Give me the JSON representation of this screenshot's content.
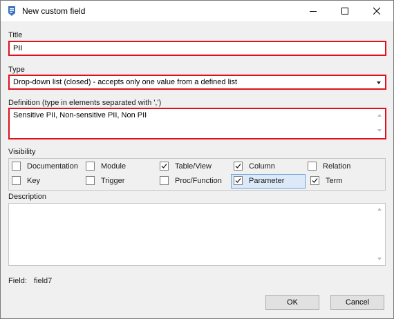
{
  "window": {
    "title": "New custom field",
    "minimize_icon": "minimize-icon",
    "maximize_icon": "maximize-icon",
    "close_icon": "close-icon"
  },
  "title_field": {
    "label": "Title",
    "value": "PII"
  },
  "type_field": {
    "label": "Type",
    "selected": "Drop-down list (closed) - accepts only one value from a defined list"
  },
  "definition_field": {
    "label": "Definition (type in elements separated with ',')",
    "value": "Sensitive PII, Non-sensitive PII, Non PII"
  },
  "visibility": {
    "label": "Visibility",
    "items": [
      {
        "label": "Documentation",
        "checked": false
      },
      {
        "label": "Module",
        "checked": false
      },
      {
        "label": "Table/View",
        "checked": true
      },
      {
        "label": "Column",
        "checked": true
      },
      {
        "label": "Relation",
        "checked": false
      },
      {
        "label": "Key",
        "checked": false
      },
      {
        "label": "Trigger",
        "checked": false
      },
      {
        "label": "Proc/Function",
        "checked": false
      },
      {
        "label": "Parameter",
        "checked": true
      },
      {
        "label": "Term",
        "checked": true
      }
    ]
  },
  "description": {
    "label": "Description",
    "value": ""
  },
  "field_info": {
    "label": "Field:",
    "value": "field7"
  },
  "buttons": {
    "ok": "OK",
    "cancel": "Cancel"
  },
  "colors": {
    "highlight_border": "#e0101e",
    "focus_fill": "#dbe9f8",
    "focus_border": "#6aa0d8"
  }
}
